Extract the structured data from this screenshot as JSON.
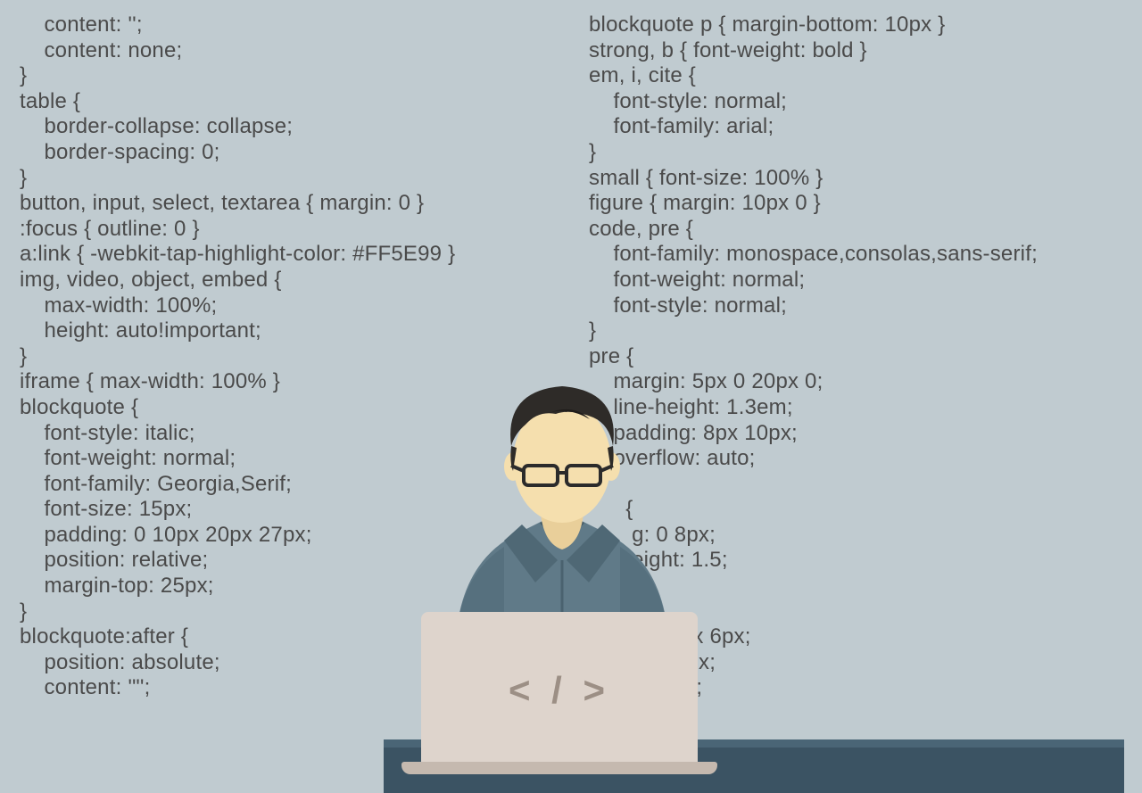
{
  "code": {
    "left": "    content: '';\n    content: none;\n}\ntable {\n    border-collapse: collapse;\n    border-spacing: 0;\n}\nbutton, input, select, textarea { margin: 0 }\n:focus { outline: 0 }\na:link { -webkit-tap-highlight-color: #FF5E99 }\nimg, video, object, embed {\n    max-width: 100%;\n    height: auto!important;\n}\niframe { max-width: 100% }\nblockquote {\n    font-style: italic;\n    font-weight: normal;\n    font-family: Georgia,Serif;\n    font-size: 15px;\n    padding: 0 10px 20px 27px;\n    position: relative;\n    margin-top: 25px;\n}\nblockquote:after {\n    position: absolute;\n    content: '\"';",
    "right": "blockquote p { margin-bottom: 10px }\nstrong, b { font-weight: bold }\nem, i, cite {\n    font-style: normal;\n    font-family: arial;\n}\nsmall { font-size: 100% }\nfigure { margin: 10px 0 }\ncode, pre {\n    font-family: monospace,consolas,sans-serif;\n    font-weight: normal;\n    font-style: normal;\n}\npre {\n    margin: 5px 0 20px 0;\n    line-height: 1.3em;\n    padding: 8px 10px;\n    overflow: auto;\n}\n      {\n       g: 0 8px;\n       eight: 1.5;\n}\n\n           : 1px 6px;\n           0 2px;\n            ack;"
  },
  "laptop": {
    "symbol": "< / >"
  }
}
